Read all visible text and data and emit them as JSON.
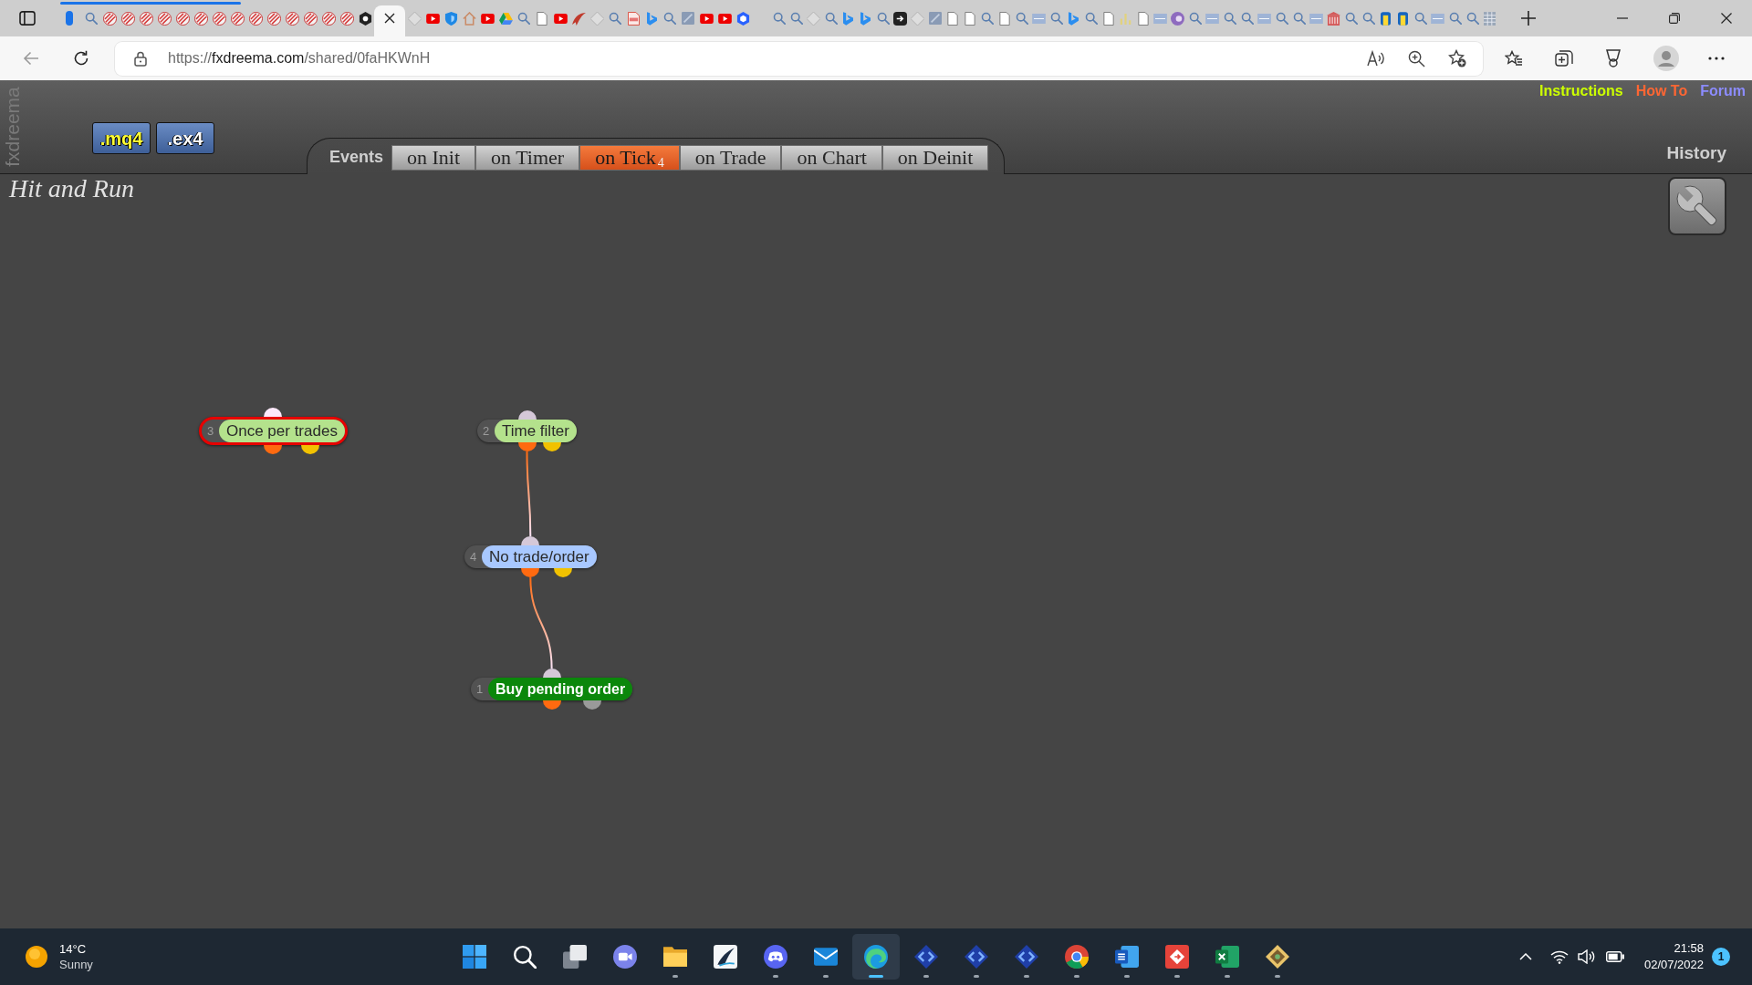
{
  "browser": {
    "tabs": [
      {
        "selected": false
      },
      {
        "selected": false
      },
      {
        "selected": false
      },
      {
        "selected": false
      },
      {
        "selected": false
      },
      {
        "selected": false
      },
      {
        "selected": false
      },
      {
        "selected": false
      },
      {
        "selected": false
      },
      {
        "selected": false
      },
      {
        "selected": false
      },
      {
        "selected": false
      },
      {
        "selected": false
      },
      {
        "selected": false
      },
      {
        "selected": false
      },
      {
        "selected": false
      },
      {
        "selected": false
      },
      {
        "selected": true
      },
      {
        "selected": false
      },
      {
        "selected": false
      },
      {
        "selected": false
      },
      {
        "selected": false
      },
      {
        "selected": false
      },
      {
        "selected": false
      },
      {
        "selected": false
      },
      {
        "selected": false
      },
      {
        "selected": false
      },
      {
        "selected": false
      },
      {
        "selected": false
      },
      {
        "selected": false
      },
      {
        "selected": false
      },
      {
        "selected": false
      },
      {
        "selected": false
      },
      {
        "selected": false
      },
      {
        "selected": false
      },
      {
        "selected": false
      },
      {
        "selected": false
      },
      {
        "selected": false
      },
      {
        "selected": false
      },
      {
        "selected": false
      },
      {
        "selected": false
      },
      {
        "selected": false
      },
      {
        "selected": false
      },
      {
        "selected": false
      },
      {
        "selected": false
      },
      {
        "selected": false
      },
      {
        "selected": false
      },
      {
        "selected": false
      },
      {
        "selected": false
      },
      {
        "selected": false
      },
      {
        "selected": false
      },
      {
        "selected": false
      },
      {
        "selected": false
      },
      {
        "selected": false
      },
      {
        "selected": false
      },
      {
        "selected": false
      },
      {
        "selected": false
      },
      {
        "selected": false
      },
      {
        "selected": false
      },
      {
        "selected": false
      },
      {
        "selected": false
      },
      {
        "selected": false
      },
      {
        "selected": false
      },
      {
        "selected": false
      },
      {
        "selected": false
      },
      {
        "selected": false
      },
      {
        "selected": false
      },
      {
        "selected": false
      },
      {
        "selected": false
      },
      {
        "selected": false
      },
      {
        "selected": false
      },
      {
        "selected": false
      },
      {
        "selected": false
      },
      {
        "selected": false
      },
      {
        "selected": false
      },
      {
        "selected": false
      },
      {
        "selected": false
      },
      {
        "selected": false
      },
      {
        "selected": false
      }
    ],
    "address": {
      "scheme": "https://",
      "host": "fxdreema.com",
      "path": "/shared/0faHKWnH"
    }
  },
  "header": {
    "brand": "fxdreema",
    "export_buttons": [
      {
        "label": ".mq4",
        "color": "#ffff33"
      },
      {
        "label": ".ex4",
        "color": "#ffffff"
      }
    ],
    "events_label": "Events",
    "event_tabs": [
      {
        "label": "on Init",
        "selected": false
      },
      {
        "label": "on Timer",
        "selected": false
      },
      {
        "label": "on Tick",
        "count": "4",
        "selected": true
      },
      {
        "label": "on Trade",
        "selected": false
      },
      {
        "label": "on Chart",
        "selected": false
      },
      {
        "label": "on Deinit",
        "selected": false
      }
    ],
    "links": [
      {
        "label": "Instructions",
        "color": "#ccff00"
      },
      {
        "label": "How To",
        "color": "#ff6633"
      },
      {
        "label": "Forum",
        "color": "#8c8cff"
      }
    ],
    "history": "History"
  },
  "canvas": {
    "title": "Hit and Run",
    "blocks": [
      {
        "number": "3",
        "label": "Once per trades",
        "kind": "condition",
        "color": "#b4e28c",
        "selected": true,
        "outputs": [
          {
            "color": "#ff6a10"
          },
          {
            "color": "#f2c200"
          }
        ]
      },
      {
        "number": "2",
        "label": "Time filter",
        "kind": "condition",
        "color": "#b4e28c",
        "selected": false,
        "outputs": [
          {
            "color": "#ff6a10"
          },
          {
            "color": "#f2c200"
          }
        ],
        "children": [
          {
            "number": "4",
            "label": "No trade/order",
            "kind": "condition",
            "color": "#a8c8ff",
            "selected": false,
            "outputs": [
              {
                "color": "#ff6a10"
              },
              {
                "color": "#f2c200"
              }
            ],
            "children": [
              {
                "number": "1",
                "label": "Buy pending order",
                "kind": "action",
                "color": "#0b870b",
                "selected": false,
                "outputs": [
                  {
                    "color": "#ff6a10"
                  },
                  {
                    "color": "#9a9a9a"
                  }
                ]
              }
            ]
          }
        ]
      }
    ]
  },
  "taskbar": {
    "weather": {
      "temperature": "14°C",
      "condition": "Sunny"
    },
    "apps": [
      {
        "running": false,
        "selected": false
      },
      {
        "running": false,
        "selected": false
      },
      {
        "running": false,
        "selected": false
      },
      {
        "running": false,
        "selected": false
      },
      {
        "running": true,
        "selected": false
      },
      {
        "running": false,
        "selected": false
      },
      {
        "running": true,
        "selected": false
      },
      {
        "running": true,
        "selected": false
      },
      {
        "running": true,
        "selected": true
      },
      {
        "running": true,
        "selected": false
      },
      {
        "running": true,
        "selected": false
      },
      {
        "running": true,
        "selected": false
      },
      {
        "running": true,
        "selected": false
      },
      {
        "running": true,
        "selected": false
      },
      {
        "running": true,
        "selected": false
      },
      {
        "running": true,
        "selected": false
      },
      {
        "running": true,
        "selected": false
      }
    ],
    "clock": {
      "time": "21:58",
      "date": "02/07/2022"
    },
    "notifications": "1"
  }
}
